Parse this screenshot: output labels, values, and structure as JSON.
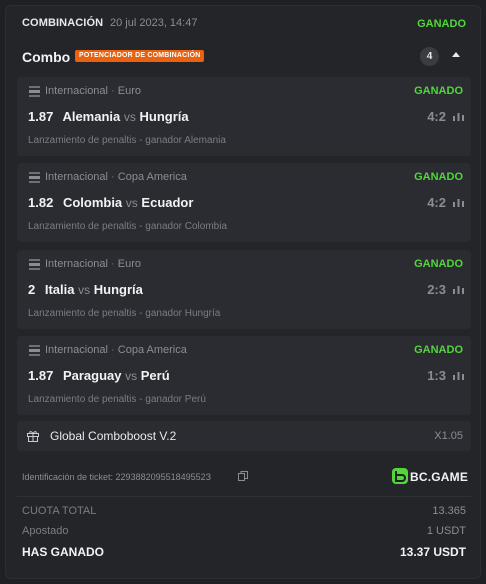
{
  "header": {
    "kind": "COMBINACIÓN",
    "date": "20 jul 2023, 14:47",
    "status": "GANADO"
  },
  "combo": {
    "title": "Combo",
    "badge": "POTENCIADOR DE COMBINACIÓN",
    "count": "4"
  },
  "bets": [
    {
      "category": "Internacional",
      "league": "Euro",
      "status": "GANADO",
      "odds": "1.87",
      "home": "Alemania",
      "vs": "vs",
      "away": "Hungría",
      "score": "4:2",
      "market": "Lanzamiento de penaltis - ganador Alemania"
    },
    {
      "category": "Internacional",
      "league": "Copa America",
      "status": "GANADO",
      "odds": "1.82",
      "home": "Colombia",
      "vs": "vs",
      "away": "Ecuador",
      "score": "4:2",
      "market": "Lanzamiento de penaltis - ganador Colombia"
    },
    {
      "category": "Internacional",
      "league": "Euro",
      "status": "GANADO",
      "odds": "2",
      "home": "Italia",
      "vs": "vs",
      "away": "Hungría",
      "score": "2:3",
      "market": "Lanzamiento de penaltis - ganador Hungría"
    },
    {
      "category": "Internacional",
      "league": "Copa America",
      "status": "GANADO",
      "odds": "1.87",
      "home": "Paraguay",
      "vs": "vs",
      "away": "Perú",
      "score": "1:3",
      "market": "Lanzamiento de penaltis - ganador Perú"
    }
  ],
  "boost": {
    "label": "Global Comboboost V.2",
    "multiplier": "X1.05"
  },
  "ticket": {
    "text": "Identificación de ticket: 229388209551849552З"
  },
  "brand": {
    "name": "BC.GAME"
  },
  "summary": {
    "total_odds_label": "CUOTA TOTAL",
    "total_odds_value": "13.365",
    "staked_label": "Apostado",
    "staked_value": "1 USDT",
    "won_label": "HAS GANADO",
    "won_value": "13.37 USDT"
  },
  "colors": {
    "won": "#52d63a",
    "badge": "#e8620f",
    "card": "#2a2c31",
    "background": "#1f2024"
  },
  "icons": {
    "sport": "fifa-logo-icon",
    "stats": "bar-chart-icon",
    "boost": "gift-icon",
    "copy": "copy-icon",
    "collapse": "caret-up-icon"
  }
}
